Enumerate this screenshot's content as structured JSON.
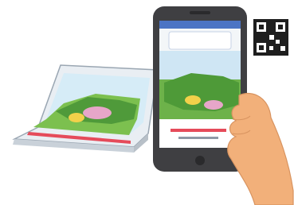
{
  "scene": {
    "description_tags": [
      "textbook",
      "smartphone",
      "hand",
      "qr-code"
    ],
    "colors": {
      "phone_body": "#3f3f42",
      "sky": "#cfe6f4",
      "grass": "#6db24a",
      "skin": "#f2b07a",
      "qr_dark": "#1e1e1e"
    }
  },
  "book": {
    "title": ""
  },
  "phone": {
    "screen_title": ""
  }
}
